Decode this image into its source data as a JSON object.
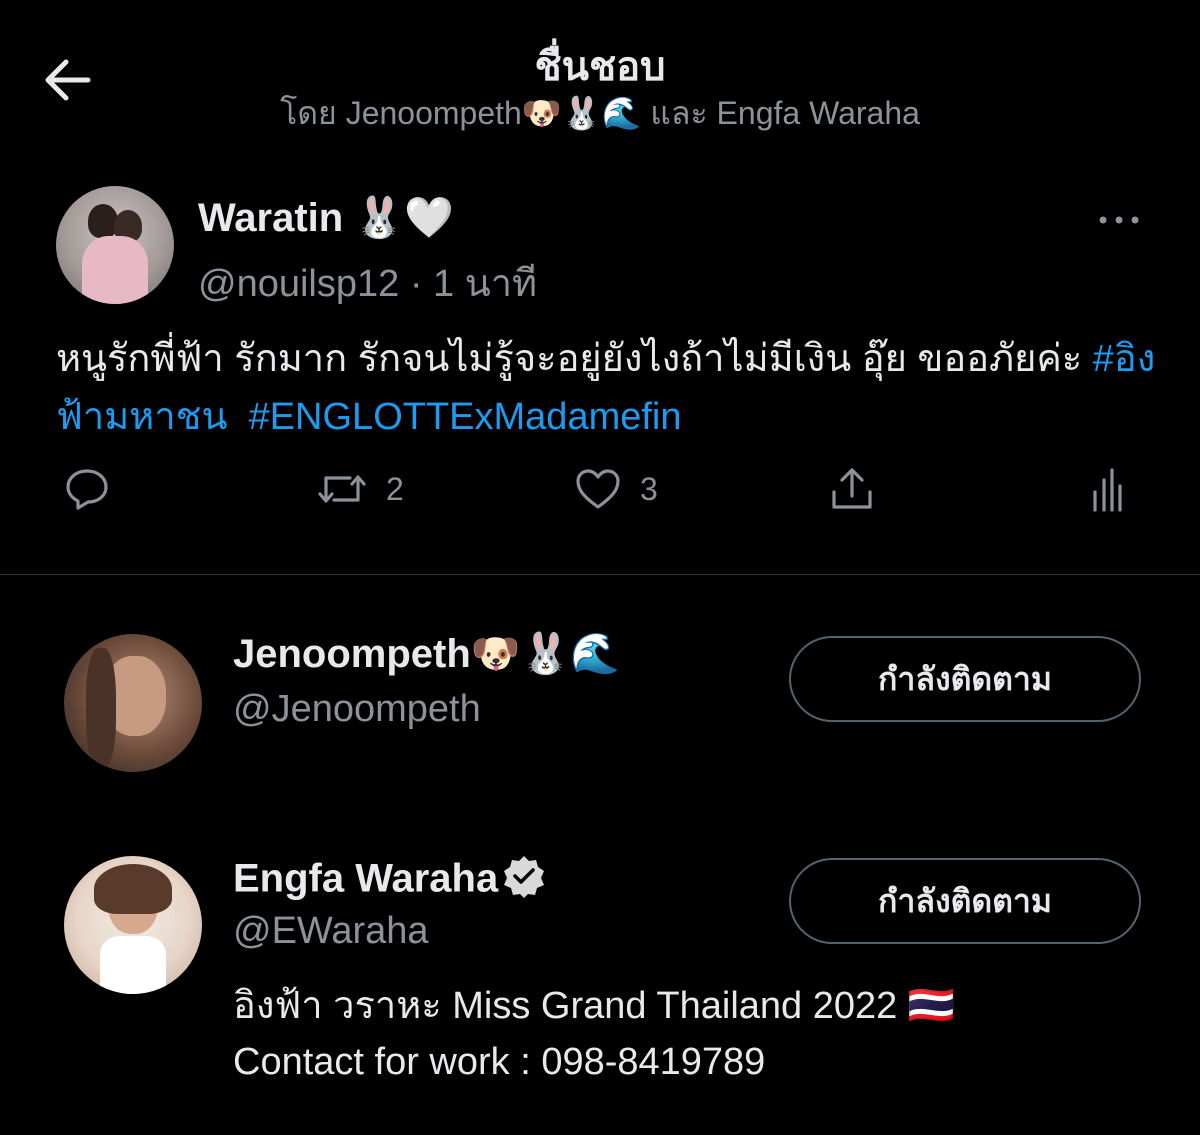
{
  "header": {
    "title": "ชื่นชอบ",
    "subtitle": "โดย Jenoompeth🐶🐰🌊 และ Engfa Waraha"
  },
  "tweet": {
    "author_name": "Waratin 🐰🤍",
    "handle_time": "@nouilsp12 · 1 นาที",
    "text": "หนูรักพี่ฟ้า รักมาก รักจนไม่รู้จะอยู่ยังไงถ้าไม่มีเงิน อุ๊ย ขออภัยค่ะ ",
    "hashtags": [
      "#อิงฟ้ามหาชน",
      "#ENGLOTTExMadamefin"
    ],
    "retweet_count": "2",
    "like_count": "3"
  },
  "users": [
    {
      "name": "Jenoompeth🐶🐰🌊",
      "handle": "@Jenoompeth",
      "follow_label": "กำลังติดตาม"
    },
    {
      "name": "Engfa Waraha",
      "handle": "@EWaraha",
      "bio_line1": "อิงฟ้า วราหะ Miss Grand Thailand 2022 🇹🇭",
      "bio_line2": "Contact for work : 098-8419789",
      "follow_label": "กำลังติดตาม"
    }
  ],
  "colors": {
    "background": "#000000",
    "text": "#e7e9ea",
    "secondary": "#8b9299",
    "link": "#1d9bf0",
    "divider": "#2f3336"
  },
  "icons": [
    "back-arrow-icon",
    "more-icon",
    "reply-icon",
    "retweet-icon",
    "like-icon",
    "share-icon",
    "analytics-icon",
    "verified-icon"
  ]
}
